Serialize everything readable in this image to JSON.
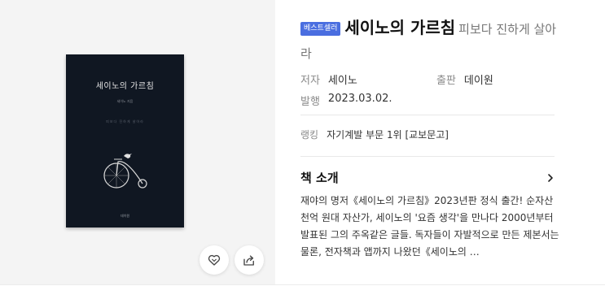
{
  "cover": {
    "title": "세이노의 가르침",
    "author": "세이노 지음",
    "tagline": "피보다 진하게 살아라",
    "publisher": "데이원"
  },
  "actions": {
    "like_icon": "heart-icon",
    "share_icon": "share-icon"
  },
  "product": {
    "badge": "베스트셀러",
    "title": "세이노의 가르침",
    "subtitle": "피보다 진하게 살아라",
    "author_label": "저자",
    "author": "세이노",
    "publisher_label": "출판",
    "publisher": "데이원",
    "date_label": "발행",
    "date": "2023.03.02.",
    "rank_label": "랭킹",
    "rank": "자기계발 부문 1위 [교보문고]"
  },
  "intro": {
    "heading": "책 소개",
    "text": "재야의 명저《세이노의 가르침》2023년판 정식 출간! 순자산 천억 원대 자산가, 세이노의 '요즘 생각'을 만나다 2000년부터 발표된 그의 주옥같은 글들. 독자들이 자발적으로 만든 제본서는 물론, 전자책과 앱까지 나왔던《세이노의 …"
  },
  "colors": {
    "badge": "#4a6ee0",
    "cover": "#101722",
    "left_panel_bg": "#f4f4f4"
  }
}
